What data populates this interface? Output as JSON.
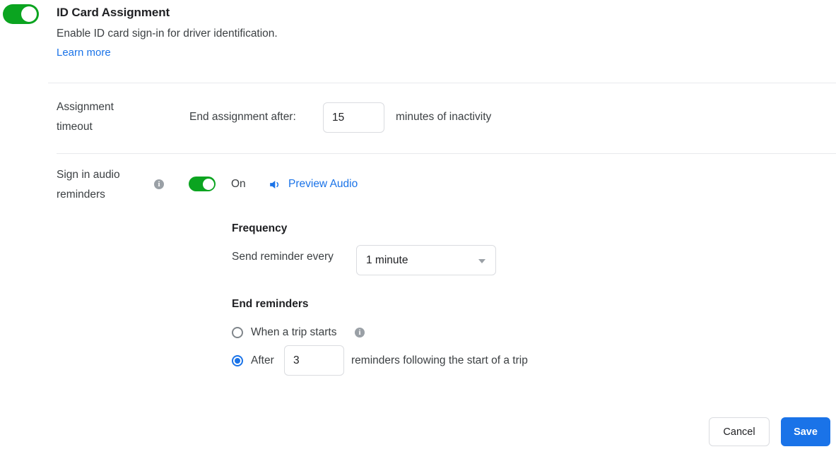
{
  "header": {
    "toggle_icon": "toggle-on-icon",
    "toggle_state": "on",
    "title": "ID Card Assignment",
    "description": "Enable ID card sign-in for driver identification.",
    "learn_more_label": "Learn more"
  },
  "assignment_timeout": {
    "label": "Assignment timeout",
    "prefix": "End assignment after:",
    "value": "15",
    "suffix": "minutes of inactivity"
  },
  "audio_reminders": {
    "label": "Sign in audio reminders",
    "info_icon": "info-icon",
    "toggle_state": "on",
    "state_label": "On",
    "speaker_icon": "speaker-icon",
    "preview_label": "Preview Audio"
  },
  "frequency": {
    "heading": "Frequency",
    "field_label": "Send reminder every",
    "selected_option": "1 minute",
    "caret_icon": "chevron-down-icon"
  },
  "end_reminders": {
    "heading": "End reminders",
    "option_trip": {
      "label": "When a trip starts",
      "selected": false,
      "info_icon": "info-icon"
    },
    "option_after": {
      "label": "After",
      "selected": true,
      "value": "3",
      "suffix": "reminders following the start of a trip"
    }
  },
  "footer": {
    "cancel_label": "Cancel",
    "save_label": "Save"
  },
  "colors": {
    "accent_blue": "#1a73e8",
    "toggle_green": "#0ba420",
    "border_gray": "#dadce0",
    "divider_gray": "#e8eaed",
    "info_gray": "#9aa0a6"
  }
}
